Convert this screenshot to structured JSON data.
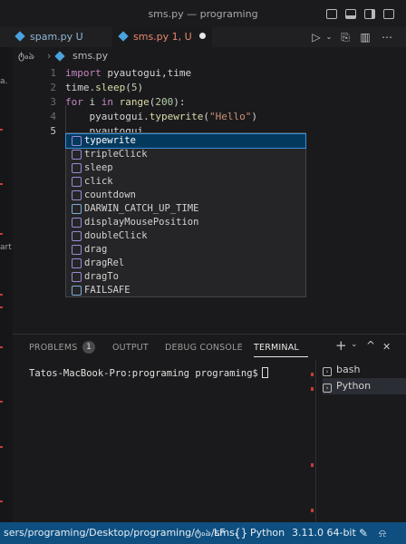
{
  "window": {
    "title": "sms.py — programing"
  },
  "tabs": [
    {
      "label": "spam.py",
      "status": "U"
    },
    {
      "label": "sms.py",
      "status": "1, U"
    }
  ],
  "breadcrumb": {
    "folder": "ტ៰ঌ",
    "file": "sms.py"
  },
  "left_strip_text": [
    "a.",
    "art"
  ],
  "editor": {
    "line_numbers": [
      "1",
      "2",
      "3",
      "4",
      "5"
    ],
    "lines": [
      {
        "tokens": [
          {
            "t": "import ",
            "c": "kw"
          },
          {
            "t": "pyautogui",
            "c": "id"
          },
          {
            "t": ",",
            "c": "id"
          },
          {
            "t": "time",
            "c": "id"
          }
        ]
      },
      {
        "tokens": [
          {
            "t": "time",
            "c": "id"
          },
          {
            "t": ".",
            "c": "id"
          },
          {
            "t": "sleep",
            "c": "fn"
          },
          {
            "t": "(",
            "c": "id"
          },
          {
            "t": "5",
            "c": "num"
          },
          {
            "t": ")",
            "c": "id"
          }
        ]
      },
      {
        "tokens": [
          {
            "t": "for ",
            "c": "kw"
          },
          {
            "t": "i ",
            "c": "id"
          },
          {
            "t": "in ",
            "c": "kw"
          },
          {
            "t": "range",
            "c": "fn"
          },
          {
            "t": "(",
            "c": "id"
          },
          {
            "t": "200",
            "c": "num"
          },
          {
            "t": "):",
            "c": "id"
          }
        ]
      },
      {
        "tokens": [
          {
            "t": "    pyautogui",
            "c": "id"
          },
          {
            "t": ".",
            "c": "id"
          },
          {
            "t": "typewrite",
            "c": "fn"
          },
          {
            "t": "(",
            "c": "id"
          },
          {
            "t": "\"Hello\"",
            "c": "str"
          },
          {
            "t": ")",
            "c": "id"
          }
        ]
      },
      {
        "tokens": [
          {
            "t": "    pyautogui",
            "c": "id"
          },
          {
            "t": ".",
            "c": "id"
          }
        ]
      }
    ]
  },
  "suggestions": [
    {
      "label": "typewrite",
      "kind": "method",
      "selected": true
    },
    {
      "label": "tripleClick",
      "kind": "method"
    },
    {
      "label": "sleep",
      "kind": "method"
    },
    {
      "label": "click",
      "kind": "method"
    },
    {
      "label": "countdown",
      "kind": "method"
    },
    {
      "label": "DARWIN_CATCH_UP_TIME",
      "kind": "variable"
    },
    {
      "label": "displayMousePosition",
      "kind": "method"
    },
    {
      "label": "doubleClick",
      "kind": "method"
    },
    {
      "label": "drag",
      "kind": "reference"
    },
    {
      "label": "dragRel",
      "kind": "method"
    },
    {
      "label": "dragTo",
      "kind": "method"
    },
    {
      "label": "FAILSAFE",
      "kind": "variable"
    }
  ],
  "panel": {
    "tabs": {
      "problems": "PROBLEMS",
      "output": "OUTPUT",
      "debug_console": "DEBUG CONSOLE",
      "terminal": "TERMINAL"
    },
    "problems_count": "1",
    "controls": {
      "add": "+",
      "chevron": "⌄",
      "maximize": "^",
      "close": "✕"
    },
    "terminal_prompt": "Tatos-MacBook-Pro:programing programing$",
    "terminals": [
      {
        "label": "bash",
        "selected": false
      },
      {
        "label": "Python",
        "selected": true
      }
    ]
  },
  "statusbar": {
    "path": "sers/programing/Desktop/programing/ტ៰ঌ/sms.",
    "eol": "LF",
    "language": "Python",
    "interpreter": "3.11.0 64-bit"
  },
  "colors": {
    "accent": "#0e4f80",
    "selection": "#04395e",
    "error": "#c43c3c"
  }
}
